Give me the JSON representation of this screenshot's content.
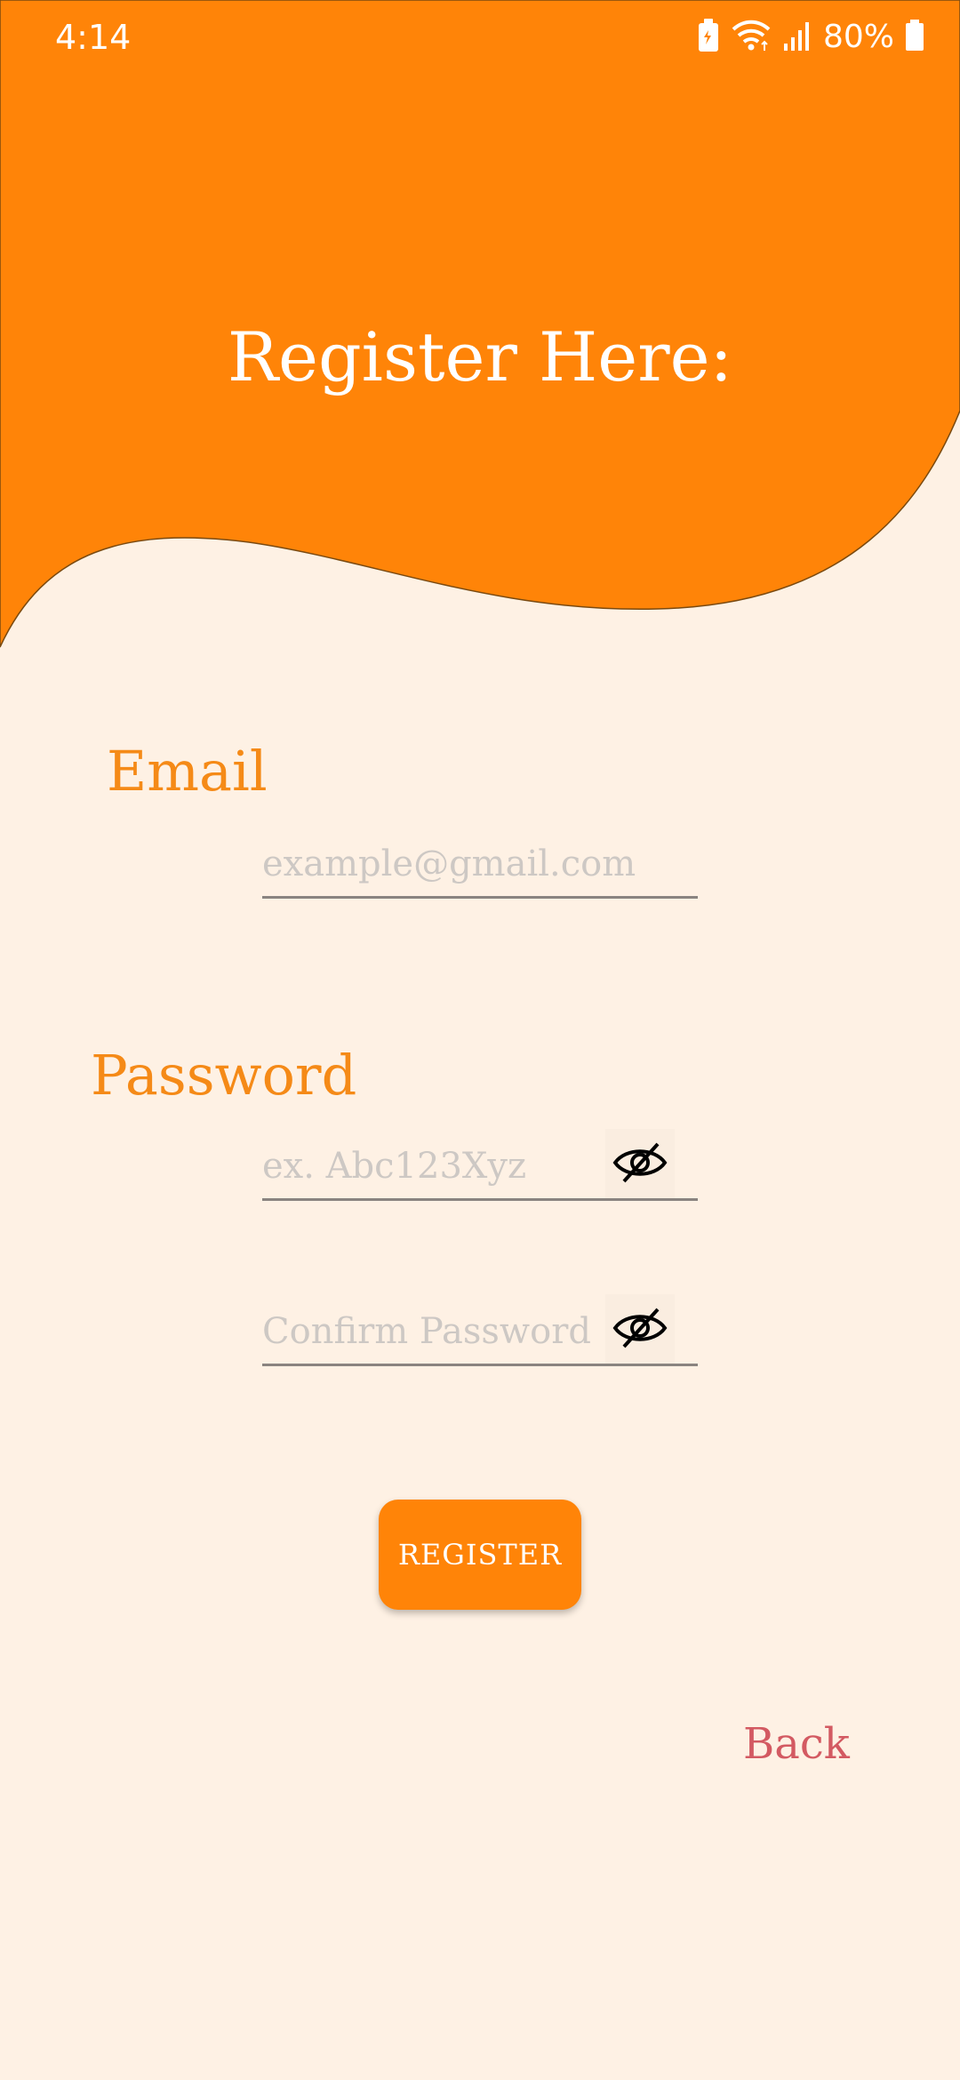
{
  "status_bar": {
    "time": "4:14",
    "battery_percent": "80%",
    "icons": [
      "battery-saver-icon",
      "wifi-icon",
      "signal-icon",
      "battery-icon"
    ]
  },
  "header": {
    "title": "Register Here:",
    "background_color": "#FF8408"
  },
  "form": {
    "email_label": "Email",
    "email_placeholder": "example@gmail.com",
    "password_label": "Password",
    "password_placeholder": "ex. Abc123Xyz",
    "confirm_placeholder": "Confirm Password",
    "visibility_icon": "eye-off-icon"
  },
  "actions": {
    "register_label": "REGISTER",
    "back_label": "Back"
  },
  "colors": {
    "accent": "#FF8408",
    "label": "#F58A17",
    "background": "#FEF1E4",
    "back_link": "#D35A62"
  }
}
